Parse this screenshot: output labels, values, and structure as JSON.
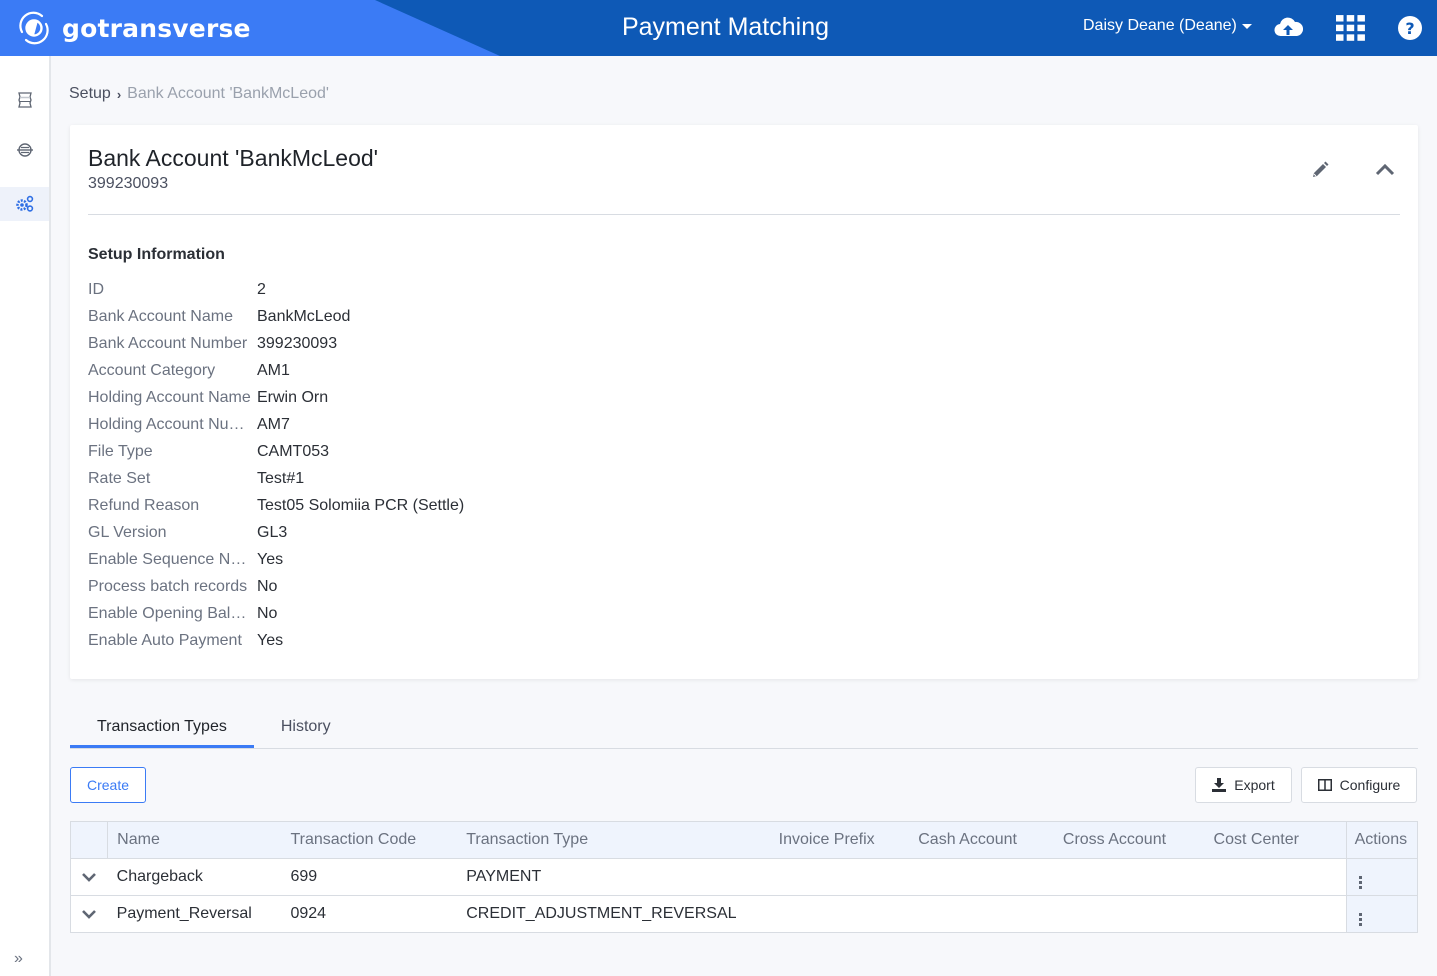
{
  "header": {
    "brand": "gotransverse",
    "app_title": "Payment Matching",
    "user": "Daisy Deane (Deane)",
    "icons": [
      "upload-cloud-icon",
      "apps-grid-icon",
      "help-icon"
    ]
  },
  "sidebar": {
    "items": [
      {
        "icon": "ledger-icon",
        "active": false
      },
      {
        "icon": "orbit-icon",
        "active": false
      },
      {
        "icon": "gears-icon",
        "active": true
      }
    ],
    "expand_label": "»"
  },
  "breadcrumb": {
    "parent": "Setup",
    "separator": "›",
    "current": "Bank Account 'BankMcLeod'"
  },
  "card": {
    "title": "Bank Account 'BankMcLeod'",
    "subtitle": "399230093",
    "section_title": "Setup Information",
    "fields": [
      {
        "label": "ID",
        "value": "2"
      },
      {
        "label": "Bank Account Name",
        "value": "BankMcLeod"
      },
      {
        "label": "Bank Account Number",
        "value": "399230093"
      },
      {
        "label": "Account Category",
        "value": "AM1"
      },
      {
        "label": "Holding Account Name",
        "value": "Erwin Orn"
      },
      {
        "label": "Holding Account Number",
        "value": "AM7"
      },
      {
        "label": "File Type",
        "value": "CAMT053"
      },
      {
        "label": "Rate Set",
        "value": "Test#1"
      },
      {
        "label": "Refund Reason",
        "value": "Test05 Solomiia PCR (Settle)"
      },
      {
        "label": "GL Version",
        "value": "GL3"
      },
      {
        "label": "Enable Sequence Number",
        "value": "Yes"
      },
      {
        "label": "Process batch records",
        "value": "No"
      },
      {
        "label": "Enable Opening Balance",
        "value": "No"
      },
      {
        "label": "Enable Auto Payment",
        "value": "Yes"
      }
    ]
  },
  "tabs": [
    {
      "label": "Transaction Types",
      "active": true
    },
    {
      "label": "History",
      "active": false
    }
  ],
  "toolbar": {
    "create_label": "Create",
    "export_label": "Export",
    "configure_label": "Configure"
  },
  "table": {
    "columns": [
      "Name",
      "Transaction Code",
      "Transaction Type",
      "Invoice Prefix",
      "Cash Account",
      "Cross Account",
      "Cost Center",
      "Actions"
    ],
    "rows": [
      {
        "name": "Chargeback",
        "code": "699",
        "type": "PAYMENT",
        "invoice_prefix": "",
        "cash_account": "",
        "cross_account": "",
        "cost_center": ""
      },
      {
        "name": "Payment_Reversal",
        "code": "0924",
        "type": "CREDIT_ADJUSTMENT_REVERSAL",
        "invoice_prefix": "",
        "cash_account": "",
        "cross_account": "",
        "cost_center": ""
      }
    ]
  },
  "colors": {
    "header_dark": "#0e59b6",
    "header_light": "#3b7bf5",
    "accent": "#3b7bf5"
  }
}
